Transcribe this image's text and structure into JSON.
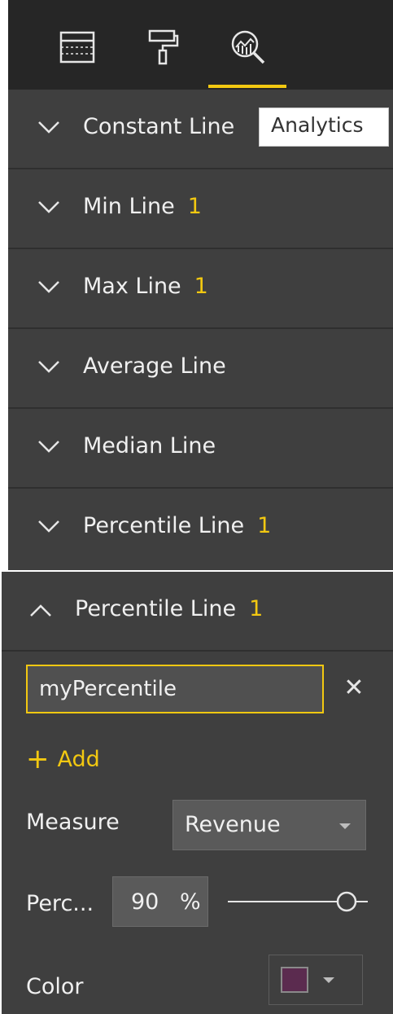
{
  "toolbar": {
    "tabs": [
      {
        "name": "Fields",
        "icon": "table-fields-icon"
      },
      {
        "name": "Format",
        "icon": "paint-roller-icon"
      },
      {
        "name": "Analytics",
        "icon": "analytics-magnifier-icon",
        "active": true
      }
    ],
    "tooltip": "Analytics"
  },
  "analytics_rows": [
    {
      "label": "Constant Line",
      "count": ""
    },
    {
      "label": "Min Line",
      "count": "1"
    },
    {
      "label": "Max Line",
      "count": "1"
    },
    {
      "label": "Average Line",
      "count": ""
    },
    {
      "label": "Median Line",
      "count": ""
    },
    {
      "label": "Percentile Line",
      "count": "1"
    }
  ],
  "expanded_section": {
    "label": "Percentile Line",
    "count": "1",
    "name_value": "myPercentile",
    "add_label": "Add",
    "measure_label": "Measure",
    "measure_value": "Revenue",
    "percentile_label": "Perc...",
    "percentile_value": "90",
    "percentile_unit": "%",
    "slider_fraction": 0.9,
    "color_label": "Color",
    "color_value": "#5b2b4f"
  },
  "colors": {
    "accent": "#f2c811",
    "panel": "#3f3f3f",
    "toolbar": "#262626"
  }
}
